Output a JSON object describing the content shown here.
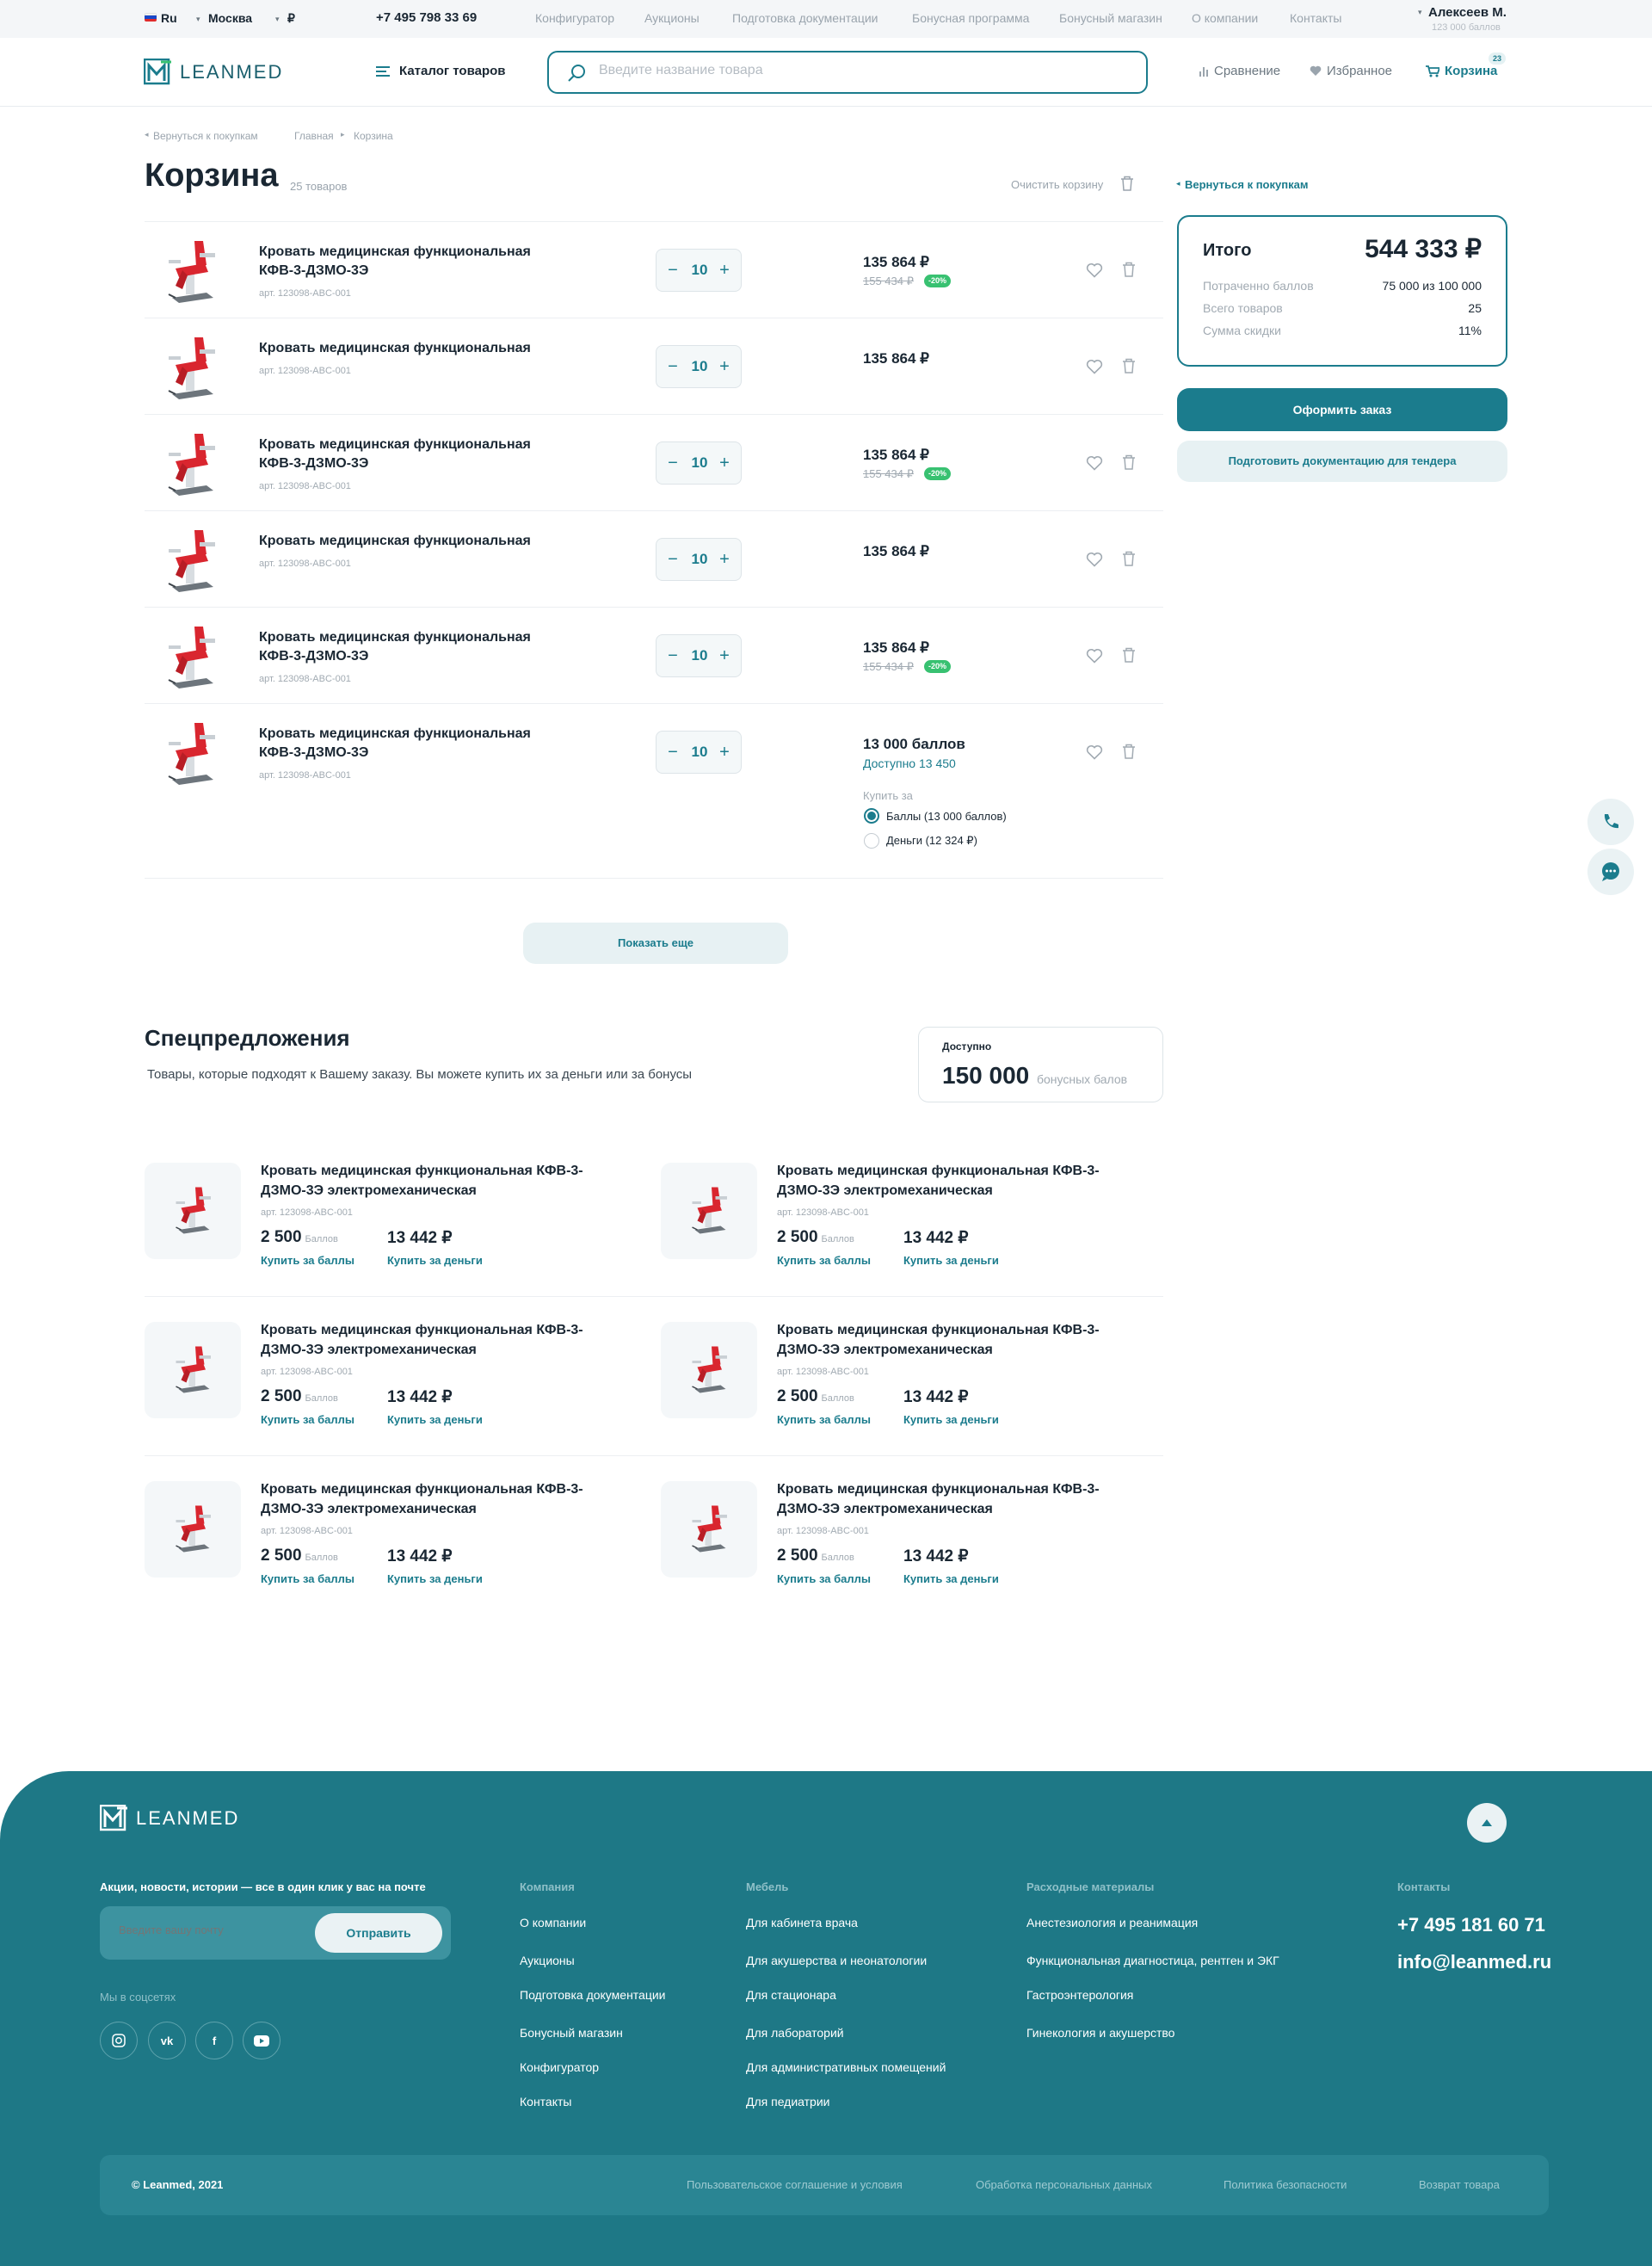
{
  "topbar": {
    "lang": "Ru",
    "city": "Москва",
    "currency": "₽",
    "phone": "+7 495 798 33 69",
    "nav": [
      "Конфигуратор",
      "Аукционы",
      "Подготовка документации",
      "Бонусная программа",
      "Бонусный магазин",
      "О компании",
      "Контакты"
    ],
    "user_name": "Алексеев М.",
    "user_points": "123 000 баллов"
  },
  "header": {
    "logo": "LEANMED",
    "catalog": "Каталог товаров",
    "search_placeholder": "Введите название товара",
    "compare": "Сравнение",
    "favorites": "Избранное",
    "cart": "Корзина",
    "cart_count": "23"
  },
  "breadcrumbs": {
    "back": "Вернуться к покупкам",
    "home": "Главная",
    "current": "Корзина"
  },
  "cart": {
    "title": "Корзина",
    "count": "25 товаров",
    "clear": "Очистить корзину",
    "items": [
      {
        "name": "Кровать медицинская функциональная КФВ-3-ДЗМО-3Э",
        "art": "арт. 123098-ABC-001",
        "qty": "10",
        "price": "135 864 ₽",
        "old_price": "155 434 ₽",
        "discount": "-20%"
      },
      {
        "name": "Кровать медицинская функциональная",
        "art": "арт. 123098-ABC-001",
        "qty": "10",
        "price": "135 864 ₽"
      },
      {
        "name": "Кровать медицинская функциональная КФВ-3-ДЗМО-3Э",
        "art": "арт. 123098-ABC-001",
        "qty": "10",
        "price": "135 864 ₽",
        "old_price": "155 434 ₽",
        "discount": "-20%"
      },
      {
        "name": "Кровать медицинская функциональная",
        "art": "арт. 123098-ABC-001",
        "qty": "10",
        "price": "135 864 ₽"
      },
      {
        "name": "Кровать медицинская функциональная КФВ-3-ДЗМО-3Э",
        "art": "арт. 123098-ABC-001",
        "qty": "10",
        "price": "135 864 ₽",
        "old_price": "155 434 ₽",
        "discount": "-20%"
      },
      {
        "name": "Кровать медицинская функциональная КФВ-3-ДЗМО-3Э",
        "art": "арт. 123098-ABC-001",
        "qty": "10",
        "price": "13 000 баллов",
        "available": "Доступно 13 450",
        "buy_for": "Купить за",
        "opt_points": "Баллы (13 000 баллов)",
        "opt_money": "Деньги (12 324 ₽)"
      }
    ],
    "show_more": "Показать еще"
  },
  "summary": {
    "back": "Вернуться к покупкам",
    "total_label": "Итого",
    "total": "544 333 ₽",
    "rows": [
      {
        "label": "Потраченно баллов",
        "value": "75 000 из 100 000"
      },
      {
        "label": "Всего товаров",
        "value": "25"
      },
      {
        "label": "Сумма скидки",
        "value": "11%"
      }
    ],
    "checkout": "Оформить заказ",
    "tender": "Подготовить документацию для тендера"
  },
  "offers": {
    "title": "Спецпредложения",
    "subtitle": "Товары, которые подходят к Вашему заказу. Вы можете купить их за деньги или за бонусы",
    "available_label": "Доступно",
    "available_value": "150 000",
    "available_unit": "бонусных балов",
    "item": {
      "name": "Кровать медицинская функциональная КФВ-3-ДЗМО-3Э электромеханическая",
      "art": "арт. 123098-ABC-001",
      "points": "2 500",
      "points_label": "Баллов",
      "money": "13 442 ₽",
      "buy_points": "Купить за баллы",
      "buy_money": "Купить за деньги"
    }
  },
  "footer": {
    "logo": "LEANMED",
    "newsletter": "Акции, новости, истории — все в один клик у вас на почте",
    "email_placeholder": "Введите вашу почту",
    "send": "Отправить",
    "social_label": "Мы в соцсетях",
    "company_head": "Компания",
    "company": [
      "О компании",
      "Аукционы",
      "Подготовка документации",
      "Бонусный магазин",
      "Конфигуратор",
      "Контакты"
    ],
    "furniture_head": "Мебель",
    "furniture": [
      "Для кабинета врача",
      "Для акушерства и неонатологии",
      "Для стационара",
      "Для лабораторий",
      "Для административных помещений",
      "Для педиатрии"
    ],
    "consumables_head": "Расходные материалы",
    "consumables": [
      "Анестезиология и реанимация",
      "Функциональная диагностица, рентген и ЭКГ",
      "Гастроэнтерология",
      "Гинекология и акушерство"
    ],
    "contacts_head": "Контакты",
    "phone": "+7 495 181 60 71",
    "email": "info@leanmed.ru",
    "copyright": "© Leanmed, 2021",
    "legal": [
      "Пользовательское соглашение и условия",
      "Обработка персональных данных",
      "Политика безопасности",
      "Возврат товара"
    ]
  },
  "colors": {
    "accent": "#1b7c8d",
    "footer": "#1e7886",
    "badge": "#38c171"
  }
}
